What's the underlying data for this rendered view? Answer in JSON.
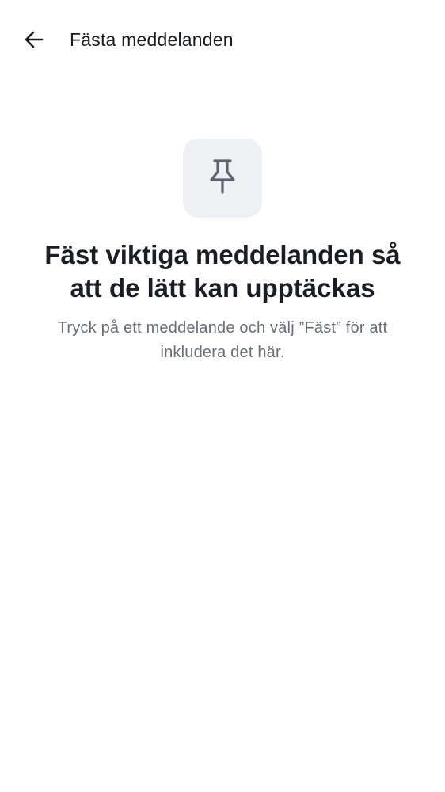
{
  "header": {
    "back_icon": "arrow-left-icon",
    "title": "Fästa meddelanden"
  },
  "empty_state": {
    "icon": "pushpin-icon",
    "headline": "Fäst viktiga meddelanden så att de lätt kan upptäckas",
    "description": "Tryck på ett meddelande och välj ”Fäst” för att inkludera det här."
  },
  "colors": {
    "background": "#ffffff",
    "text_primary": "#1c1d22",
    "text_secondary": "#6b6e78",
    "icon_tile": "#eff0f4",
    "icon_stroke": "#5f636f"
  }
}
